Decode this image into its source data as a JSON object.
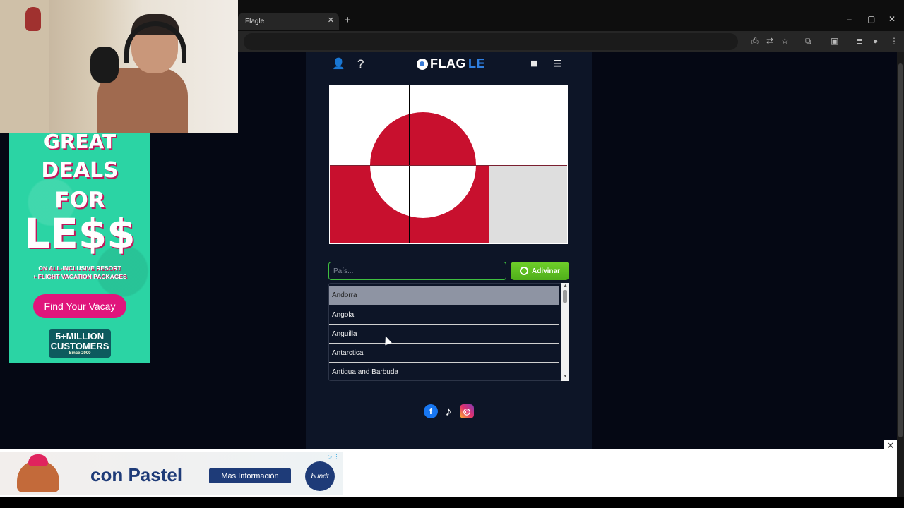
{
  "browser": {
    "tab_title": "Flagle",
    "tab_close": "✕",
    "new_tab": "+",
    "window_controls": {
      "minimize": "–",
      "maximize": "▢",
      "close": "✕"
    }
  },
  "header": {
    "logo_main": "FLAG",
    "logo_accent": "LE",
    "profile_icon": "👤",
    "help_icon": "?",
    "stats_icon": "▮▮",
    "menu_icon": "≡"
  },
  "game": {
    "input_placeholder": "País...",
    "guess_button": "Adivinar",
    "dropdown_items": [
      "Andorra",
      "Angola",
      "Anguilla",
      "Antarctica",
      "Antigua and Barbuda"
    ]
  },
  "social": {
    "facebook": "f",
    "tiktok": "♪",
    "instagram": "◎"
  },
  "side_ad": {
    "line1": "GREAT",
    "line2": "DEALS",
    "line3": "FOR",
    "line4": "LE$$",
    "sub1": "ON ALL-INCLUSIVE RESORT",
    "sub2": "+ FLIGHT VACATION PACKAGES",
    "cta": "Find Your Vacay",
    "badge_main": "5+MILLION CUSTOMERS",
    "badge_sub": "Since 2000"
  },
  "bottom_ad": {
    "headline": "con Pastel",
    "button": "Más Información",
    "brand": "bundt"
  },
  "colors": {
    "flag_red": "#c8102e",
    "accent_green": "#4fae1a",
    "page_bg": "#0d1527"
  }
}
